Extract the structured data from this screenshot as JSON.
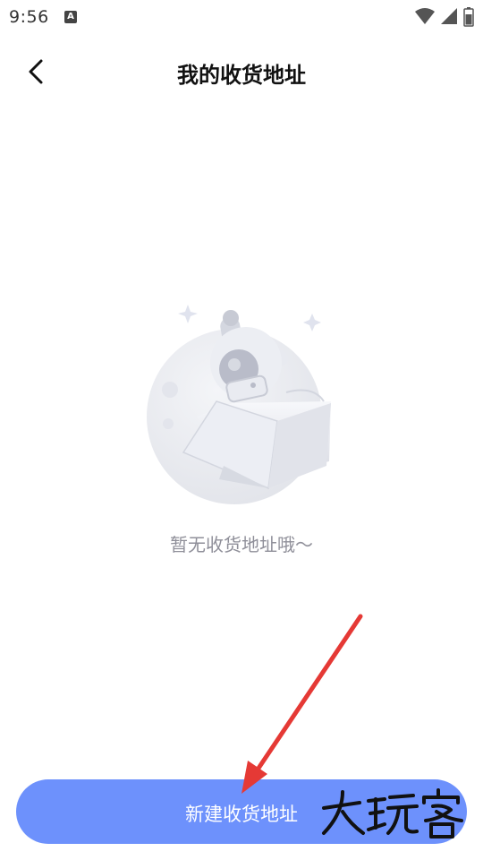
{
  "status_bar": {
    "time": "9:56",
    "notification_icon": "a-badge-icon",
    "icons": [
      "wifi-icon",
      "signal-icon",
      "battery-icon"
    ]
  },
  "header": {
    "back_icon": "chevron-left-icon",
    "title": "我的收货地址"
  },
  "empty_state": {
    "illustration": "astronaut-moon-illustration",
    "message": "暂无收货地址哦～"
  },
  "footer": {
    "new_address_label": "新建收货地址"
  },
  "watermark": {
    "text": "大玩客"
  },
  "colors": {
    "primary_button": "#6d91fc",
    "empty_text": "#8f8f99",
    "annotation_arrow": "#e53935"
  }
}
